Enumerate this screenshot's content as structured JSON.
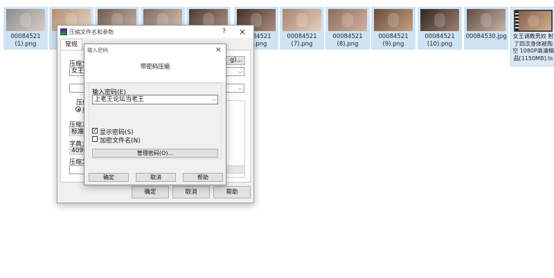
{
  "files": [
    {
      "name": "00084521\n(1).png",
      "colors": [
        "#8a8a8a",
        "#d9cfc5"
      ]
    },
    {
      "name": "",
      "colors": [
        "#b48c70",
        "#e8d6c8"
      ]
    },
    {
      "name": "",
      "colors": [
        "#6e5a50",
        "#c9b3a5"
      ]
    },
    {
      "name": "",
      "colors": [
        "#7d6c62",
        "#d8c2b0"
      ]
    },
    {
      "name": "",
      "colors": [
        "#4b3a34",
        "#b49484"
      ]
    },
    {
      "name": "00084521\n(6).png",
      "colors": [
        "#3d302c",
        "#b08e7c"
      ]
    },
    {
      "name": "00084521\n(7).png",
      "colors": [
        "#a88470",
        "#e6cfbd"
      ]
    },
    {
      "name": "00084521\n(8).png",
      "colors": [
        "#8c6a5a",
        "#d4b2a0"
      ]
    },
    {
      "name": "00084521\n(9).png",
      "colors": [
        "#6a4d3c",
        "#c69d80"
      ]
    },
    {
      "name": "00084521\n(10).png",
      "colors": [
        "#2f2622",
        "#a08070"
      ]
    },
    {
      "name": "00084530.jpg",
      "colors": [
        "#5e4a40",
        "#c8b4a6"
      ]
    },
    {
      "name": "女王调教男奴 射\n了四次身体被掏\n空 1080P高清稿\n品[1150MB].ts",
      "colors": [
        "#7a5a46",
        "#d6ae8a"
      ]
    }
  ],
  "outer_dialog": {
    "title": "压缩文件名和参数",
    "help_icon": "?",
    "close_icon": "×",
    "tab_general": "常规",
    "label_archive_name": "压缩文",
    "archive_name_value": "女王调",
    "browse_button_fragment": "g)...",
    "label_compression_format": "压缩",
    "radio_default": "默",
    "label_compression_method": "压缩方",
    "method_value": "标准",
    "label_dictionary_size": "字典大",
    "dictionary_value": "4096",
    "label_split": "压缩为",
    "ok": "确定",
    "cancel": "取消",
    "help": "帮助"
  },
  "password_dialog": {
    "title": "输入密码",
    "close_icon": "×",
    "header": "带密码压缩",
    "label_enter_password": "输入密码(E)",
    "password_value": "上老王论坛当老王",
    "show_password": "显示密码(S)",
    "show_password_checked": true,
    "encrypt_filenames": "加密文件名(N)",
    "encrypt_filenames_checked": false,
    "manage_passwords": "管理密码(O)...",
    "ok": "确定",
    "cancel": "取消",
    "help": "帮助"
  }
}
